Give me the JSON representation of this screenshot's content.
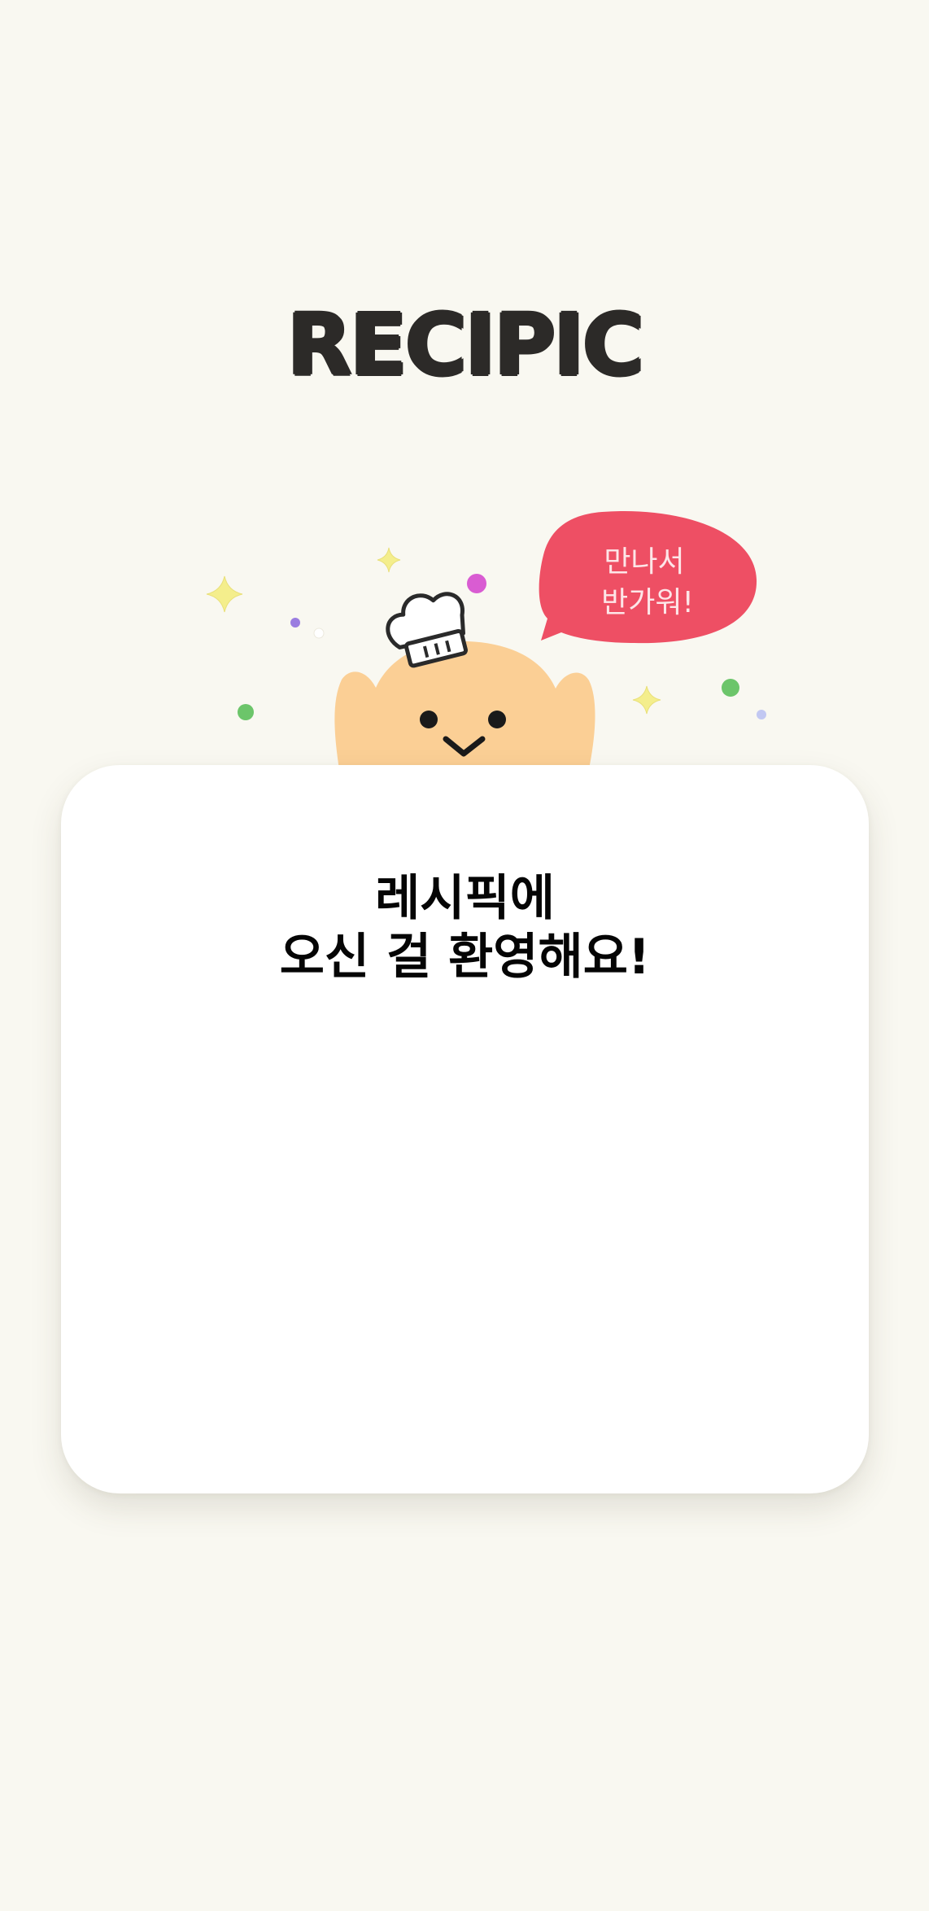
{
  "app": {
    "logo_text": "RECIPIC"
  },
  "mascot": {
    "speech_line1": "만나서",
    "speech_line2": "반가워!"
  },
  "welcome": {
    "line1": "레시픽에",
    "line2": "오신 걸 환영해요!"
  },
  "colors": {
    "background": "#f9f8f1",
    "logo": "#2c2a28",
    "bubble": "#ee4f64",
    "mascot_body": "#fbcf95",
    "card": "#ffffff",
    "text": "#050505"
  },
  "icons": [
    "chef-mascot-icon",
    "speech-bubble-icon",
    "sparkle-icon"
  ]
}
